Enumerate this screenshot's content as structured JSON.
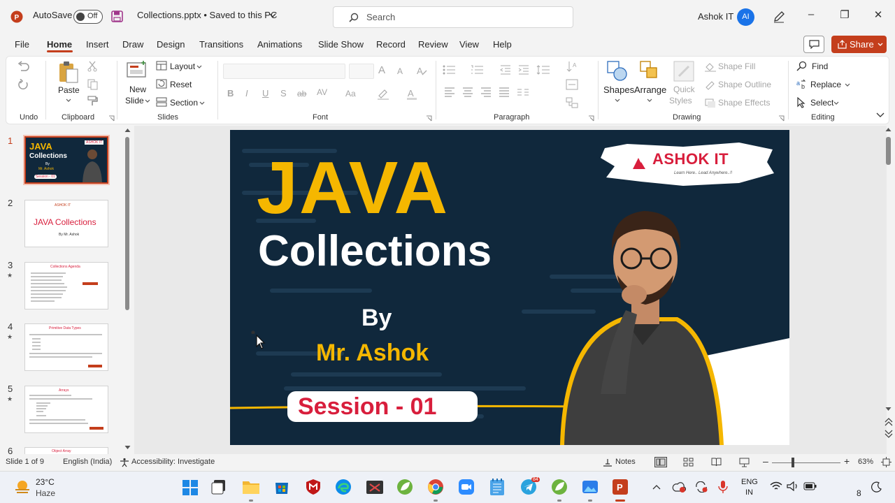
{
  "titlebar": {
    "app_icon": "powerpoint-icon",
    "autosave_label": "AutoSave",
    "autosave_state": "Off",
    "save_icon": "save-icon",
    "file_title": "Collections.pptx • Saved to this PC",
    "search_placeholder": "Search",
    "user_name": "Ashok IT",
    "user_initials": "AI"
  },
  "menu": {
    "tabs": [
      "File",
      "Home",
      "Insert",
      "Draw",
      "Design",
      "Transitions",
      "Animations",
      "Slide Show",
      "Record",
      "Review",
      "View",
      "Help"
    ],
    "active_tab": "Home",
    "share_label": "Share"
  },
  "ribbon": {
    "undo_group": "Undo",
    "clipboard": {
      "paste": "Paste",
      "group": "Clipboard"
    },
    "slides": {
      "new_slide": "New",
      "new_slide2": "Slide",
      "layout": "Layout",
      "reset": "Reset",
      "section": "Section",
      "group": "Slides"
    },
    "font": {
      "group": "Font",
      "bold": "B",
      "italic": "I",
      "underline": "U",
      "shadow": "S",
      "strike": "ab",
      "spacing": "AV",
      "case": "Aa",
      "grow": "A",
      "shrink": "A"
    },
    "paragraph": {
      "group": "Paragraph"
    },
    "drawing": {
      "shapes": "Shapes",
      "arrange": "Arrange",
      "quick_styles": "Quick",
      "quick_styles2": "Styles",
      "shape_fill": "Shape Fill",
      "shape_outline": "Shape Outline",
      "shape_effects": "Shape Effects",
      "group": "Drawing"
    },
    "editing": {
      "find": "Find",
      "replace": "Replace",
      "select": "Select",
      "group": "Editing"
    }
  },
  "slide_thumbnails": [
    {
      "num": "1",
      "star": ""
    },
    {
      "num": "2",
      "star": ""
    },
    {
      "num": "3",
      "star": "★"
    },
    {
      "num": "4",
      "star": "★"
    },
    {
      "num": "5",
      "star": "★"
    },
    {
      "num": "6",
      "star": ""
    }
  ],
  "thumb_text": {
    "t1_java": "JAVA",
    "t1_collections": "Collections",
    "t1_by": "By",
    "t1_mr": "Mr. Ashok",
    "t1_session": "Session - 01",
    "t1_logo": "ASHOK IT",
    "t2_title": "JAVA  Collections",
    "t2_by": "By Mr. Ashok",
    "t2_logo": "ASHOK IT",
    "t3_title": "Collections Agenda",
    "t4_title": "Primitive Data Types",
    "t5_title": "Arrays",
    "t6_title": "Object Array"
  },
  "slide": {
    "logo_text": "ASHOK IT",
    "logo_tagline": "Learn Here.. Lead Anywhere..!!",
    "title_line1": "JAVA",
    "title_line2": "Collections",
    "by": "By",
    "author": "Mr. Ashok",
    "session": "Session - 01"
  },
  "statusbar": {
    "slide_of": "Slide 1 of 9",
    "language": "English (India)",
    "accessibility": "Accessibility: Investigate",
    "notes": "Notes",
    "zoom": "63%"
  },
  "taskbar": {
    "temperature": "23°C",
    "weather": "Haze",
    "lang_top": "ENG",
    "lang_bottom": "IN",
    "telegram_badge": "84",
    "clock_fragment": "8"
  },
  "colors": {
    "accent": "#c43e1c",
    "slide_bg": "#10283c",
    "title_yellow": "#f5b700",
    "session_red": "#d81e3c"
  }
}
